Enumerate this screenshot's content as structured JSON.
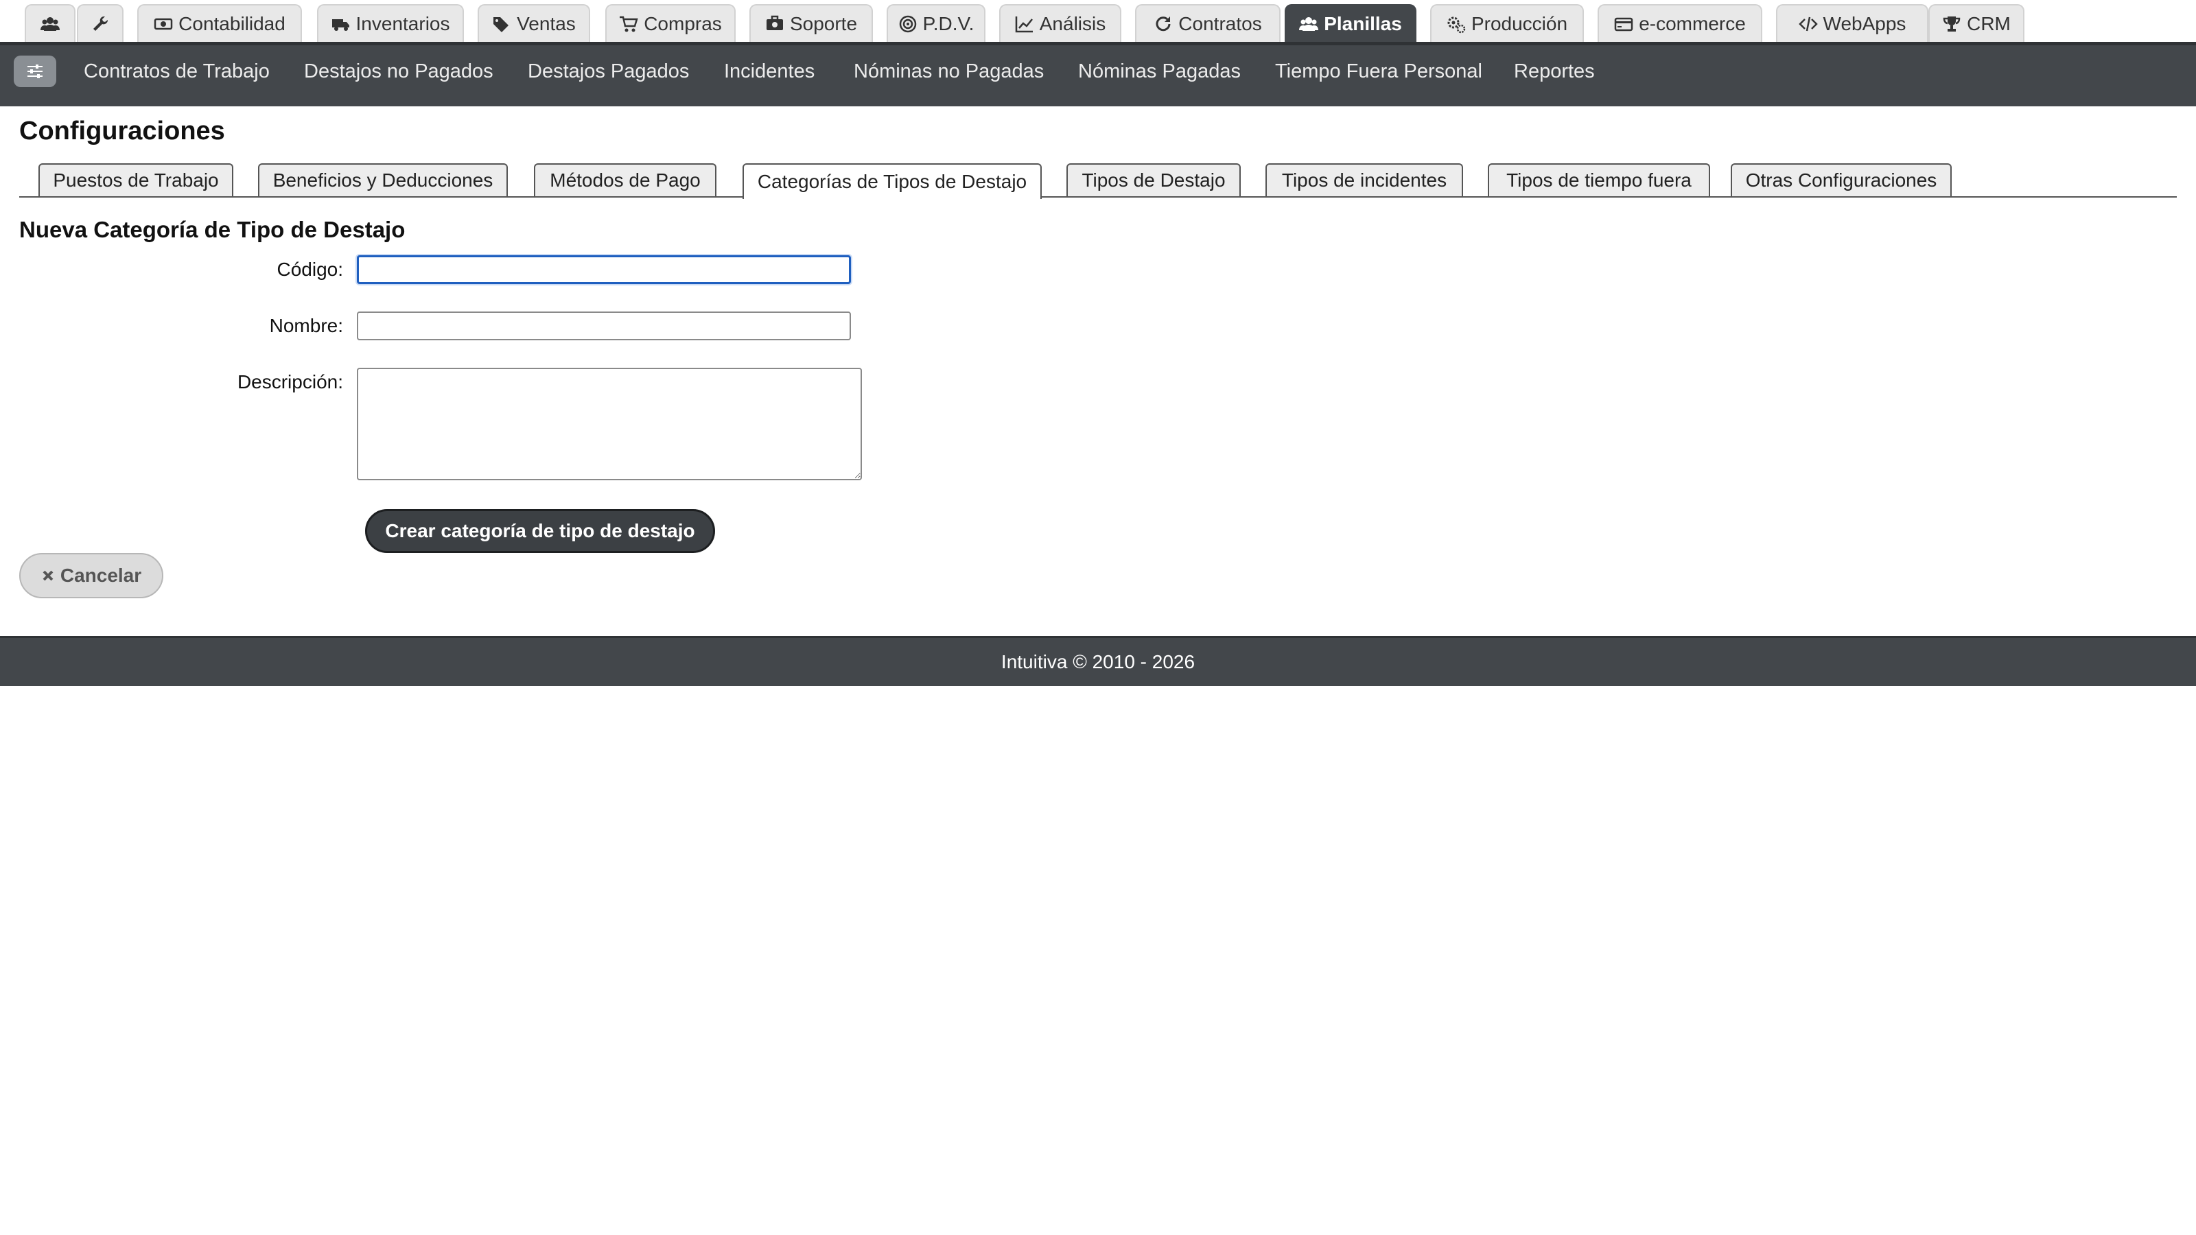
{
  "modules": [
    {
      "label": "",
      "icon": "users-icon"
    },
    {
      "label": "",
      "icon": "wrench-icon"
    },
    {
      "label": "Contabilidad",
      "icon": "money-icon"
    },
    {
      "label": "Inventarios",
      "icon": "truck-icon"
    },
    {
      "label": "Ventas",
      "icon": "tags-icon"
    },
    {
      "label": "Compras",
      "icon": "cart-icon"
    },
    {
      "label": "Soporte",
      "icon": "support-icon"
    },
    {
      "label": "P.D.V.",
      "icon": "target-icon"
    },
    {
      "label": "Análisis",
      "icon": "chart-line-icon"
    },
    {
      "label": "Contratos",
      "icon": "refresh-icon"
    },
    {
      "label": "Planillas",
      "icon": "users-icon",
      "active": true
    },
    {
      "label": "Producción",
      "icon": "gears-icon"
    },
    {
      "label": "e-commerce",
      "icon": "credit-card-icon"
    },
    {
      "label": "WebApps",
      "icon": "code-icon"
    },
    {
      "label": "CRM",
      "icon": "trophy-icon"
    }
  ],
  "submenu": [
    "Contratos de Trabajo",
    "Destajos no Pagados",
    "Destajos Pagados",
    "Incidentes",
    "Nóminas no Pagadas",
    "Nóminas Pagadas",
    "Tiempo Fuera Personal",
    "Reportes"
  ],
  "page": {
    "title": "Configuraciones"
  },
  "config_tabs": [
    "Puestos de Trabajo",
    "Beneficios y Deducciones",
    "Métodos de Pago",
    "Categorías de Tipos de Destajo",
    "Tipos de Destajo",
    "Tipos de incidentes",
    "Tipos de tiempo fuera",
    "Otras Configuraciones"
  ],
  "active_config_tab": "Categorías de Tipos de Destajo",
  "form": {
    "title": "Nueva Categoría de Tipo de Destajo",
    "codigo_label": "Código:",
    "codigo_value": "",
    "nombre_label": "Nombre:",
    "nombre_value": "",
    "descripcion_label": "Descripción:",
    "descripcion_value": "",
    "submit_label": "Crear categoría de tipo de destajo",
    "cancel_label": "Cancelar"
  },
  "footer": {
    "text": "Intuitiva © 2010 - 2026"
  },
  "colors": {
    "dark_bar": "#43474b",
    "focus_border": "#1f5fbf",
    "tab_bg": "#e8e8e8"
  }
}
